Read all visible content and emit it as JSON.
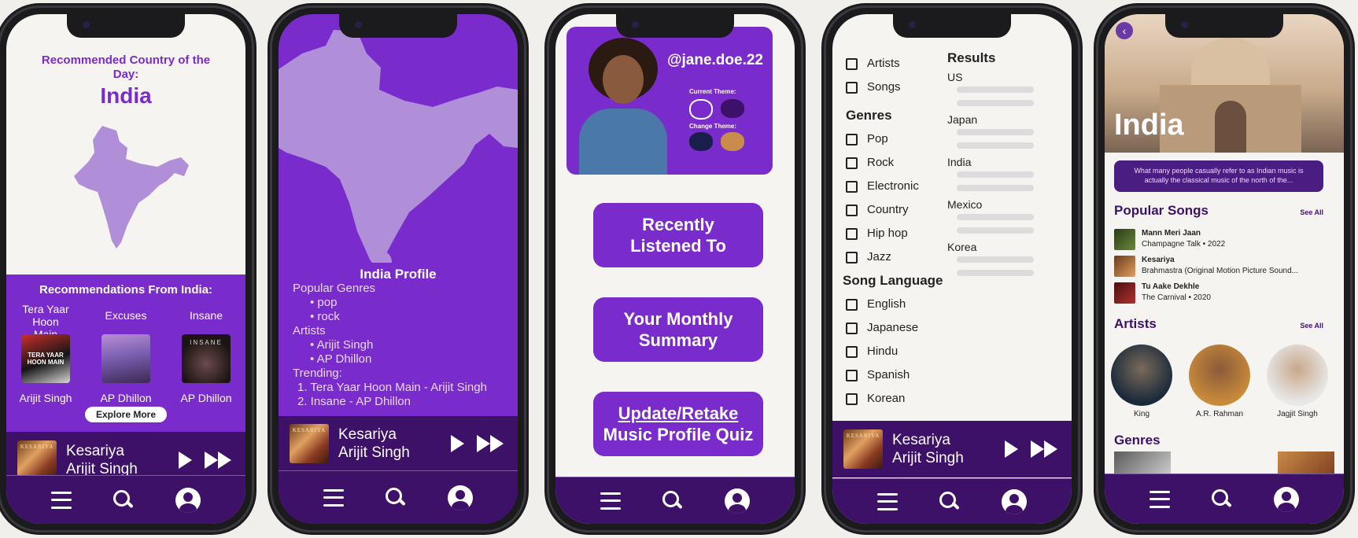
{
  "screen1": {
    "heading": "Recommended Country of the Day:",
    "country": "India",
    "reco_title": "Recommendations From India:",
    "recos": [
      {
        "song": "Tera Yaar Hoon Main",
        "artist": "Arijit Singh",
        "cover_text": "TERA YAAR HOON MAIN"
      },
      {
        "song": "Excuses",
        "artist": "AP Dhillon"
      },
      {
        "song": "Insane",
        "artist": "AP Dhillon",
        "cover_text": "INSANE"
      }
    ],
    "explore": "Explore More"
  },
  "screen2": {
    "title": "India Profile",
    "genres_label": "Popular Genres",
    "genres": [
      "pop",
      "rock"
    ],
    "artists_label": "Artists",
    "artists": [
      "Arijit Singh",
      "AP Dhillon"
    ],
    "trending_label": "Trending:",
    "trending": [
      "1. Tera Yaar Hoon Main - Arijit Singh",
      "2. Insane - AP Dhillon"
    ]
  },
  "screen3": {
    "username": "@jane.doe.22",
    "current_theme": "Current Theme:",
    "change_theme": "Change Theme:",
    "btn1": [
      "Recently",
      "Listened To"
    ],
    "btn2": [
      "Your Monthly",
      "Summary"
    ],
    "btn3": [
      "Update/Retake",
      "Music Profile Quiz"
    ]
  },
  "screen4": {
    "types": [
      "Artists",
      "Songs"
    ],
    "genres_label": "Genres",
    "genres": [
      "Pop",
      "Rock",
      "Electronic",
      "Country",
      "Hip hop",
      "Jazz"
    ],
    "lang_label": "Song Language",
    "languages": [
      "English",
      "Japanese",
      "Hindu",
      "Spanish",
      "Korean"
    ],
    "results_label": "Results",
    "results": [
      "US",
      "Japan",
      "India",
      "Mexico",
      "Korea"
    ]
  },
  "screen5": {
    "title": "India",
    "description": "What many people casually refer to as Indian music is actually the classical music of the north of the...",
    "songs_label": "Popular Songs",
    "see_all": "See All",
    "songs": [
      {
        "title": "Mann Meri Jaan",
        "sub": "Champagne Talk  • 2022"
      },
      {
        "title": "Kesariya",
        "sub": "Brahmastra (Original Motion Picture Sound..."
      },
      {
        "title": "Tu Aake Dekhle",
        "sub": "The Carnival  • 2020"
      }
    ],
    "artists_label": "Artists",
    "artists": [
      "King",
      "A.R. Rahman",
      "Jagjit Singh"
    ],
    "genres_label": "Genres"
  },
  "player": {
    "song": "Kesariya",
    "artist": "Arijit Singh",
    "cover_text": "KESARIYA"
  },
  "colors": {
    "accent": "#7a2bcc",
    "dark": "#3e1169",
    "map": "#b08fd8"
  }
}
